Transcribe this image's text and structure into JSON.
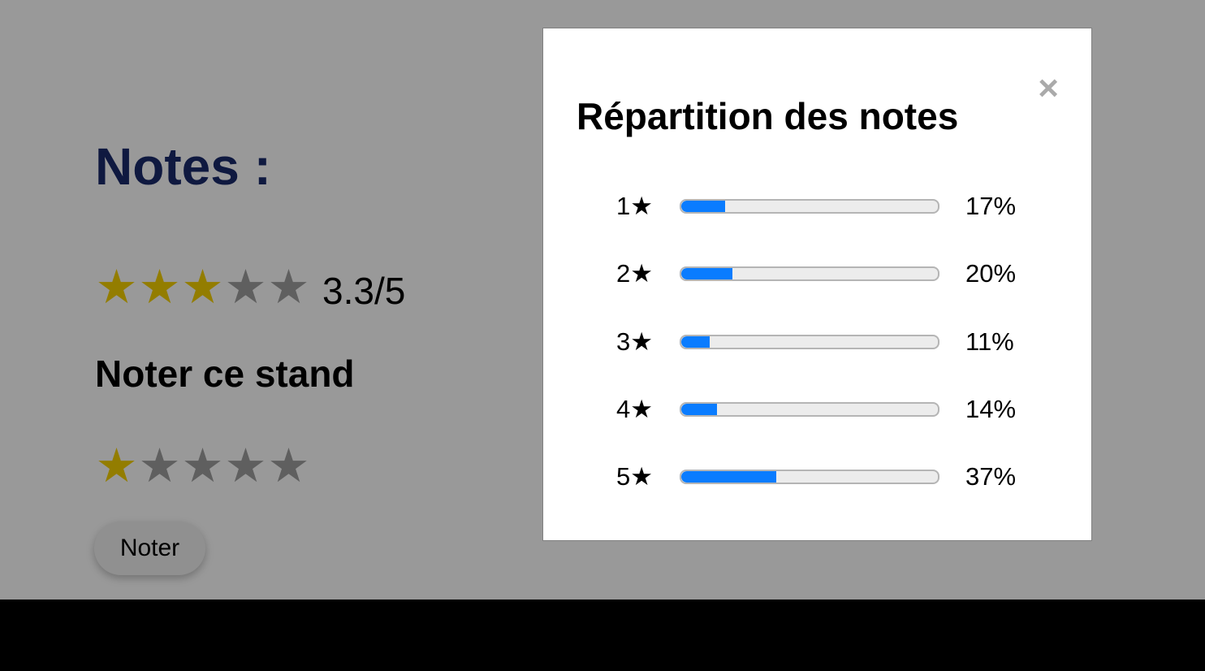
{
  "page": {
    "notes_title": "Notes :",
    "average": {
      "stars_filled": 3,
      "stars_total": 5,
      "value_text": "3.3/5"
    },
    "rate_section": {
      "title": "Noter ce stand",
      "selected_stars": 1,
      "stars_total": 5,
      "submit_label": "Noter"
    },
    "star_glyph": "★"
  },
  "modal": {
    "title": "Répartition des notes",
    "close_label": "×",
    "rows": [
      {
        "label": "1★",
        "percent_text": "17%",
        "percent": 17
      },
      {
        "label": "2★",
        "percent_text": "20%",
        "percent": 20
      },
      {
        "label": "3★",
        "percent_text": "11%",
        "percent": 11
      },
      {
        "label": "4★",
        "percent_text": "14%",
        "percent": 14
      },
      {
        "label": "5★",
        "percent_text": "37%",
        "percent": 37
      }
    ]
  },
  "colors": {
    "title": "#1a2a6c",
    "star_on": "#f5d000",
    "star_off": "#9e9e9e",
    "bar_fill": "#0a7cff",
    "overlay": "rgba(0,0,0,0.4)"
  },
  "icons": {
    "close": "close-icon",
    "star": "star-icon"
  }
}
